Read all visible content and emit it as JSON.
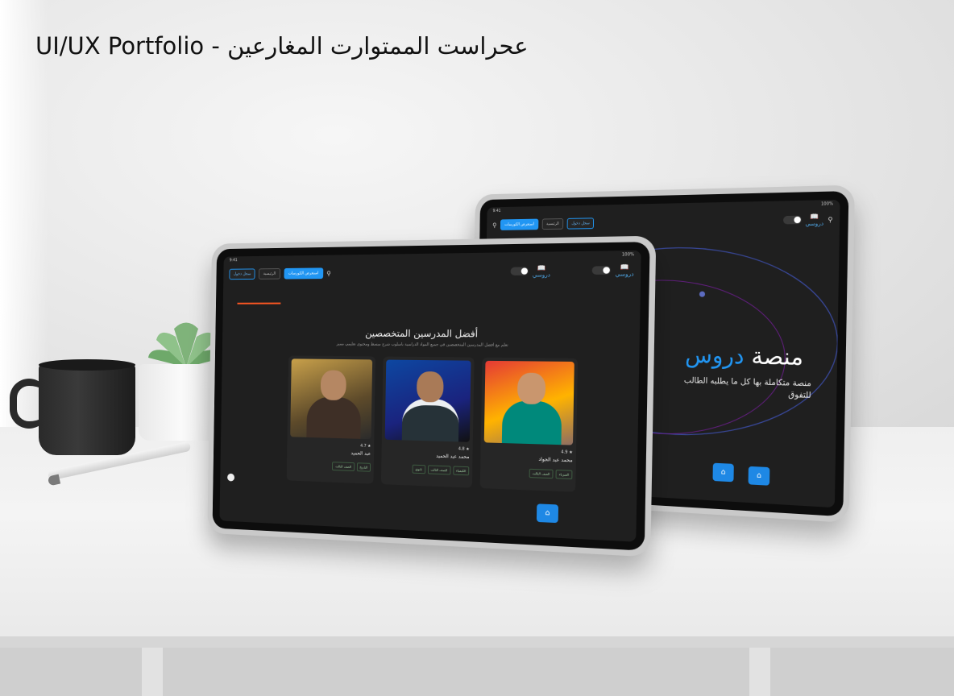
{
  "title": {
    "latin": "UI/UX Portfolio -",
    "arabic": "عحراست الممتوارت المغارعين"
  },
  "colors": {
    "accent": "#2196f3",
    "orange": "#ff5722",
    "screen_bg": "#1f1f1f"
  },
  "back_tablet": {
    "status": {
      "left": "9:41",
      "right": "100%"
    },
    "nav": {
      "buttons": [
        "استعرض الكورسات",
        "الرئيسية",
        "سجل دخول"
      ],
      "search_icon": "search-icon",
      "logo": "دروسي"
    },
    "hero": {
      "title_plain": "منصة",
      "title_accent": "دروس",
      "subtitle": "منصة متكاملة بها كل ما يطلبه الطالب للتفوق"
    },
    "fab_icon": "home-icon"
  },
  "front_tablet": {
    "status": {
      "left": "9:41",
      "right": "100%"
    },
    "nav": {
      "buttons": [
        "استعرض الكورسات",
        "الرئيسية",
        "سجل دخول"
      ],
      "logo": "دروسي"
    },
    "section": {
      "title": "أفضل المدرسين المتخصصين",
      "subtitle": "تعلم مع أفضل المدرسين المتخصصين في جميع المواد الدراسية بأسلوب شرح مبسط ومحتوى تعليمي مميز"
    },
    "cards": [
      {
        "meta": "★ 4.9",
        "name": "محمد عبد الجواد",
        "tags": [
          "الفيزياء",
          "الصف الثالث"
        ]
      },
      {
        "meta": "★ 4.8",
        "name": "محمد عبد الحميد",
        "tags": [
          "الكيمياء",
          "الصف الثالث",
          "ثانوي"
        ]
      },
      {
        "meta": "★ 4.7",
        "name": "عبد الحميد",
        "tags": [
          "التاريخ",
          "الصف الثالث"
        ]
      }
    ]
  }
}
